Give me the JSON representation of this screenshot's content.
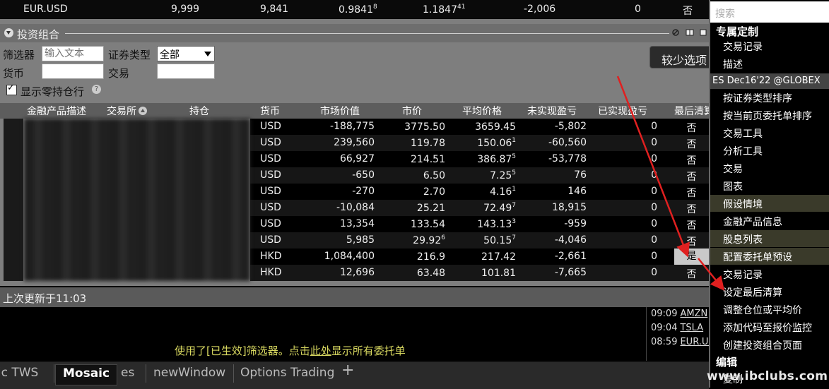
{
  "top_quote": {
    "symbol": "EUR.USD",
    "c1": "9,999",
    "c2": "9,841",
    "c3": "0.9841",
    "c3_frac": "8",
    "c4": "1.1847",
    "c4_frac": "41",
    "c5": "-2,006",
    "c6": "0",
    "c7": "否"
  },
  "panel": {
    "title": "投资组合",
    "filter_label": "筛选器",
    "filter_placeholder": "输入文本",
    "sectype_label": "证券类型",
    "sectype_value": "全部",
    "currency_label": "货币",
    "exchange_label": "交易",
    "show_zero_label": "显示零持仓行",
    "fewer_options": "较少选项"
  },
  "table": {
    "headers": [
      "金融产品描述",
      "交易所",
      "持仓",
      "货币",
      "市场价值",
      "市价",
      "平均价格",
      "未实现盈亏",
      "已实现盈亏",
      "最后清算"
    ],
    "rows": [
      {
        "cur": "USD",
        "mv": "-188,775",
        "px": "3775.50",
        "avg": "3659.45",
        "avg_f": "",
        "upl": "-5,802",
        "rpl": "0",
        "last": "否"
      },
      {
        "cur": "USD",
        "mv": "239,560",
        "px": "119.78",
        "avg": "150.06",
        "avg_f": "1",
        "upl": "-60,560",
        "rpl": "0",
        "last": "否"
      },
      {
        "cur": "USD",
        "mv": "66,927",
        "px": "214.51",
        "avg": "386.87",
        "avg_f": "5",
        "upl": "-53,778",
        "rpl": "0",
        "last": "否"
      },
      {
        "cur": "USD",
        "mv": "-650",
        "px": "6.50",
        "avg": "7.25",
        "avg_f": "5",
        "upl": "76",
        "rpl": "0",
        "last": "否"
      },
      {
        "cur": "USD",
        "mv": "-270",
        "px": "2.70",
        "avg": "4.16",
        "avg_f": "1",
        "upl": "146",
        "rpl": "0",
        "last": "否"
      },
      {
        "cur": "USD",
        "mv": "-10,084",
        "px": "25.21",
        "avg": "72.49",
        "avg_f": "7",
        "upl": "18,915",
        "rpl": "0",
        "last": "否"
      },
      {
        "cur": "USD",
        "mv": "13,354",
        "px": "133.54",
        "avg": "143.13",
        "avg_f": "3",
        "upl": "-959",
        "rpl": "0",
        "last": "否"
      },
      {
        "cur": "USD",
        "mv": "5,985",
        "px": "29.92",
        "px_f": "6",
        "avg": "50.15",
        "avg_f": "7",
        "upl": "-4,046",
        "rpl": "0",
        "last": "否"
      },
      {
        "cur": "HKD",
        "mv": "1,084,400",
        "px": "216.9",
        "avg": "217.42",
        "avg_f": "",
        "upl": "-2,661",
        "rpl": "0",
        "last": "是"
      },
      {
        "cur": "HKD",
        "mv": "12,696",
        "px": "63.48",
        "avg": "101.81",
        "avg_f": "",
        "upl": "-7,665",
        "rpl": "0",
        "last": "否"
      }
    ]
  },
  "status": {
    "updated": "上次更新于11:03"
  },
  "filter_msg": {
    "pre": "使用了[已生效]筛选器。点击",
    "link": "此处",
    "post": "显示所有委托单"
  },
  "quotes": [
    {
      "time": "09:09",
      "sym": "AMZN"
    },
    {
      "time": "09:04",
      "sym": "TSLA"
    },
    {
      "time": "08:59",
      "sym": "EUR.US"
    }
  ],
  "tabs": [
    "sic TWS",
    "Mosaic",
    "es",
    "newWindow",
    "Options Trading"
  ],
  "active_tab": "Mosaic",
  "menu": {
    "search_placeholder": "搜索",
    "section1": "专属定制",
    "items_a": [
      "交易记录",
      "描述"
    ],
    "contract": "ES Dec16'22 @GLOBEX",
    "items_b": [
      "按证券类型排序",
      "按当前页委托单排序"
    ],
    "items_c": [
      "交易工具",
      "分析工具",
      "交易",
      "图表",
      "假设情境",
      "金融产品信息",
      "股息列表",
      "配置委托单预设",
      "交易记录",
      "设定最后清算",
      "调整仓位或平均价",
      "添加代码至报价监控",
      "创建投资组合页面"
    ],
    "section2": "编辑",
    "partial": "复制"
  },
  "watermark": "www.ibclubs.com",
  "colors": {
    "arrow": "#e02020",
    "filter_msg": "#d8d860"
  }
}
